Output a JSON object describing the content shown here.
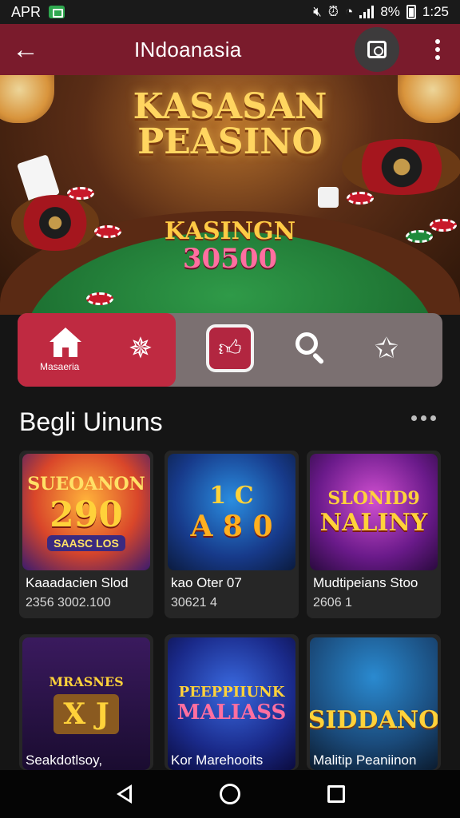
{
  "status_bar": {
    "carrier": "APR",
    "percent": "8%",
    "time": "1:25"
  },
  "app_bar": {
    "title": "INdoanasia"
  },
  "hero": {
    "title_line1": "KASASAN",
    "title_line2": "PEASINO",
    "sub_line1": "KASINGN",
    "sub_line2": "30500"
  },
  "action_bar": {
    "home_label": "Masaeria"
  },
  "section": {
    "title": "Begli Uinuns"
  },
  "cards": [
    {
      "art_line1": "SUEOANON",
      "art_line2": "290",
      "art_line3": "SAASC LOS",
      "title": "Kaaadacien Slod",
      "meta": "2356 3002.100"
    },
    {
      "art_line1": "1 C",
      "art_line2": "A 8 0",
      "art_line3": "",
      "title": "kao Oter 07",
      "meta": "30621 4"
    },
    {
      "art_line1": "SLONID9",
      "art_line2": "NALINY",
      "art_line3": "",
      "title": "Mudtipeians Stoo",
      "meta": "2606 1"
    },
    {
      "art_line1": "MRASNES",
      "art_line2": "X J",
      "art_line3": "",
      "title": "Seakdotlsoy,",
      "meta": ""
    },
    {
      "art_line1": "PEEPPIIUNK",
      "art_line2": "MALIASS",
      "art_line3": "",
      "title": "Kor Marehooits",
      "meta": ""
    },
    {
      "art_line1": "SIDDANO",
      "art_line2": "",
      "art_line3": "",
      "title": "Malitip Peaniinon",
      "meta": ""
    }
  ],
  "colors": {
    "app_bar": "#7a1b2c",
    "accent": "#bf2a41",
    "felt": "#2f9a48",
    "gold": "#ffd560"
  }
}
